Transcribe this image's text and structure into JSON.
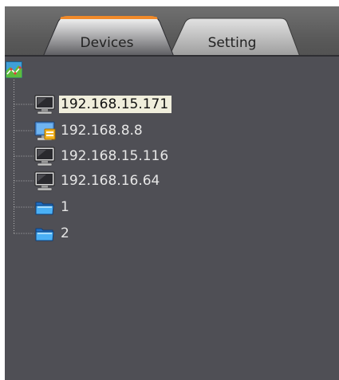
{
  "tabs": [
    {
      "label": "Devices",
      "active": true
    },
    {
      "label": "Setting",
      "active": false
    }
  ],
  "tree": {
    "root_icon": "network-map-icon",
    "nodes": [
      {
        "label": "192.168.15.171",
        "icon": "monitor-icon",
        "selected": true
      },
      {
        "label": "192.168.8.8",
        "icon": "monitor-alert-icon",
        "selected": false
      },
      {
        "label": "192.168.15.116",
        "icon": "monitor-icon",
        "selected": false
      },
      {
        "label": "192.168.16.64",
        "icon": "monitor-icon",
        "selected": false
      },
      {
        "label": "1",
        "icon": "folder-icon",
        "selected": false
      },
      {
        "label": "2",
        "icon": "folder-icon",
        "selected": false
      }
    ]
  },
  "colors": {
    "panel_bg": "#4f4f55",
    "active_tab_accent": "#f08a2a",
    "selected_item_bg": "#f0eedc",
    "item_text": "#e6e6e6"
  }
}
